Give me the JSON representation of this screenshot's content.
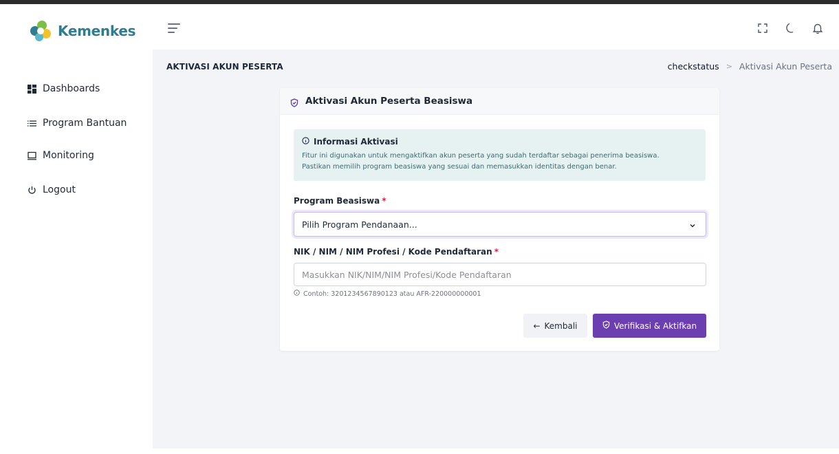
{
  "app": {
    "brand": "Kemenkes",
    "brand_color": "#2f7d8e",
    "accent_color": "#6c3fb0"
  },
  "header": {
    "icons": [
      "menu-toggle-icon",
      "fullscreen-icon",
      "dark-mode-icon",
      "notification-bell-icon"
    ]
  },
  "sidebar": {
    "items": [
      {
        "label": "Dashboards",
        "icon": "grid-icon"
      },
      {
        "label": "Program Bantuan",
        "icon": "list-icon"
      },
      {
        "label": "Monitoring",
        "icon": "monitor-icon"
      },
      {
        "label": "Logout",
        "icon": "power-icon"
      }
    ]
  },
  "page": {
    "title": "AKTIVASI AKUN PESERTA",
    "breadcrumb": {
      "link": "checkstatus",
      "separator": ">",
      "current": "Aktivasi Akun Peserta"
    }
  },
  "card": {
    "title": "Aktivasi Akun Peserta Beasiswa",
    "info": {
      "title": "Informasi Aktivasi",
      "line1": "Fitur ini digunakan untuk mengaktifkan akun peserta yang sudah terdaftar sebagai penerima beasiswa.",
      "line2": "Pastikan memilih program beasiswa yang sesuai dan memasukkan identitas dengan benar."
    },
    "program": {
      "label": "Program Beasiswa",
      "required_mark": "*",
      "selected": "Pilih Program Pendanaan..."
    },
    "identity": {
      "label": "NIK / NIM / NIM Profesi / Kode Pendaftaran",
      "required_mark": "*",
      "placeholder": "Masukkan NIK/NIM/NIM Profesi/Kode Pendaftaran",
      "value": "",
      "hint": "Contoh: 3201234567890123 atau AFR-220000000001"
    },
    "buttons": {
      "back": "Kembali",
      "back_arrow": "←",
      "submit": "Verifikasi & Aktifkan"
    }
  }
}
